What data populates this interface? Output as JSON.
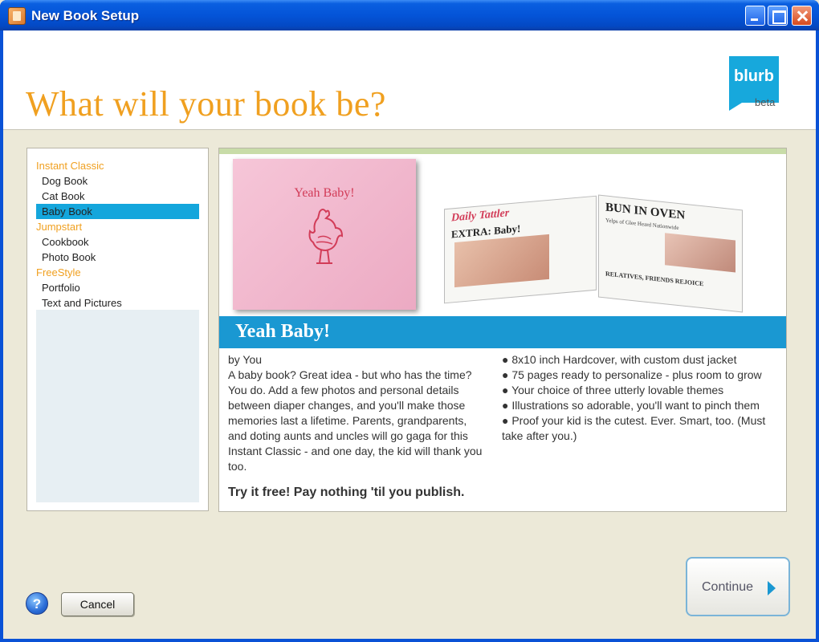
{
  "window": {
    "title": "New Book Setup"
  },
  "header": {
    "headline": "What will your book be?",
    "logo": "blurb",
    "logo_badge": "beta"
  },
  "list": {
    "items": [
      {
        "label": "Instant Classic",
        "type": "category"
      },
      {
        "label": "Dog Book",
        "type": "item"
      },
      {
        "label": "Cat Book",
        "type": "item"
      },
      {
        "label": "Baby Book",
        "type": "item",
        "selected": true
      },
      {
        "label": "Jumpstart",
        "type": "category"
      },
      {
        "label": "Cookbook",
        "type": "item"
      },
      {
        "label": "Photo Book",
        "type": "item"
      },
      {
        "label": "FreeStyle",
        "type": "category"
      },
      {
        "label": "Portfolio",
        "type": "item"
      },
      {
        "label": "Text and Pictures",
        "type": "item"
      }
    ]
  },
  "detail": {
    "cover_title": "Yeah Baby!",
    "newspaper": {
      "masthead": "Daily Tattler",
      "left_headline": "EXTRA: Baby!",
      "right_headline": "BUN IN OVEN",
      "right_subhead": "Yelps of Glee Heard Nationwide",
      "right_footer": "RELATIVES, FRIENDS REJOICE"
    },
    "banner_title": "Yeah Baby!",
    "author": "by You",
    "description": "A baby book? Great idea - but who has the time? You do. Add a few photos and personal details between diaper changes, and you'll make those memories last a lifetime. Parents, grandparents, and doting aunts and uncles will go gaga for this Instant Classic - and one day, the kid will thank you too.",
    "features": [
      "● 8x10 inch Hardcover, with custom dust jacket",
      "● 75 pages ready to personalize - plus room to grow",
      "● Your choice of three utterly lovable themes",
      "● Illustrations so adorable, you'll want to pinch them",
      "● Proof your kid is the cutest. Ever. Smart, too. (Must take after you.)"
    ],
    "tagline": "Try it free! Pay nothing 'til you publish."
  },
  "footer": {
    "help_label": "?",
    "cancel_label": "Cancel",
    "continue_label": "Continue"
  },
  "colors": {
    "accent_orange": "#f0a020",
    "accent_blue": "#1a98d2",
    "selection": "#14a6dc"
  }
}
